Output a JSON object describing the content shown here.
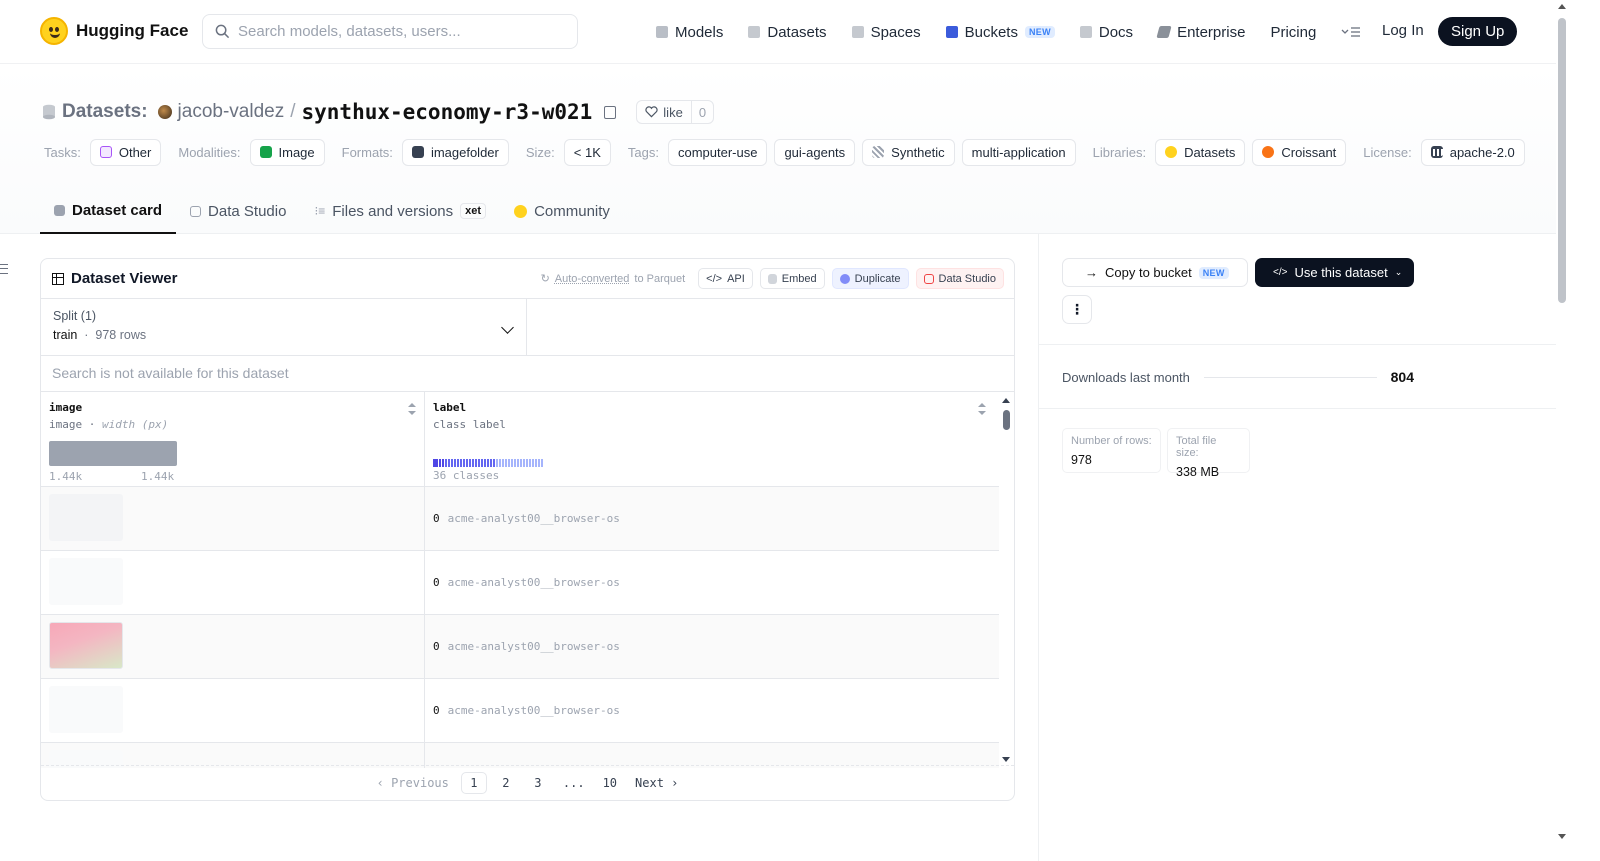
{
  "nav": {
    "brand": "Hugging Face",
    "search_placeholder": "Search models, datasets, users...",
    "items": [
      {
        "label": "Models",
        "icon": "cube-icon",
        "color": "#9ca3af"
      },
      {
        "label": "Datasets",
        "icon": "database-icon",
        "color": "#9ca3af"
      },
      {
        "label": "Spaces",
        "icon": "grid-icon",
        "color": "#9ca3af"
      },
      {
        "label": "Buckets",
        "icon": "bucket-icon",
        "color": "#3b5bdb",
        "badge": "NEW"
      },
      {
        "label": "Docs",
        "icon": "book-icon",
        "color": "#9ca3af"
      },
      {
        "label": "Enterprise",
        "icon": "enterprise-icon",
        "color": "#6b7280"
      },
      {
        "label": "Pricing"
      }
    ],
    "login": "Log In",
    "signup": "Sign Up"
  },
  "repo": {
    "kind": "Datasets:",
    "owner": "jacob-valdez",
    "separator": "/",
    "name": "synthux-economy-r3-w021",
    "like_label": "like",
    "like_count": "0"
  },
  "tags": {
    "tasks_label": "Tasks:",
    "task": "Other",
    "modalities_label": "Modalities:",
    "modality": "Image",
    "formats_label": "Formats:",
    "format": "imagefolder",
    "size_label": "Size:",
    "size": "< 1K",
    "tags_label": "Tags:",
    "tag_list": [
      "computer-use",
      "gui-agents",
      "Synthetic",
      "multi-application"
    ],
    "libraries_label": "Libraries:",
    "libraries": [
      "Datasets",
      "Croissant"
    ],
    "license_label": "License:",
    "license": "apache-2.0"
  },
  "tabs": [
    {
      "label": "Dataset card",
      "active": true
    },
    {
      "label": "Data Studio"
    },
    {
      "label": "Files and versions",
      "badge": "xet"
    },
    {
      "label": "Community"
    }
  ],
  "viewer": {
    "title": "Dataset Viewer",
    "auto_converted": "Auto-converted",
    "auto_converted_suffix": "to Parquet",
    "buttons": {
      "api": "API",
      "embed": "Embed",
      "duplicate": "Duplicate",
      "data_studio": "Data Studio"
    },
    "split_label": "Split (1)",
    "split_name": "train",
    "split_rows": "978 rows",
    "search_unavailable": "Search is not available for this dataset",
    "columns": [
      {
        "name": "image",
        "type": "image",
        "type_extra": "width (px)",
        "hist_min": "1.44k",
        "hist_max": "1.44k"
      },
      {
        "name": "label",
        "type": "class label",
        "classes_text": "36 classes"
      }
    ],
    "rows": [
      {
        "thumb": "light",
        "label_id": "0",
        "label_name": "acme-analyst00__browser-os"
      },
      {
        "thumb": "light",
        "label_id": "0",
        "label_name": "acme-analyst00__browser-os"
      },
      {
        "thumb": "pink",
        "label_id": "0",
        "label_name": "acme-analyst00__browser-os"
      },
      {
        "thumb": "light",
        "label_id": "0",
        "label_name": "acme-analyst00__browser-os"
      }
    ],
    "pager": {
      "prev": "Previous",
      "pages": [
        "1",
        "2",
        "3",
        "...",
        "10"
      ],
      "next": "Next",
      "current": "1"
    }
  },
  "sidebar": {
    "copy_bucket": "Copy to bucket",
    "copy_bucket_badge": "NEW",
    "use_dataset": "Use this dataset",
    "downloads_label": "Downloads last month",
    "downloads_value": "804",
    "rows_label": "Number of rows:",
    "rows_value": "978",
    "size_label": "Total file size:",
    "size_value": "338 MB"
  }
}
